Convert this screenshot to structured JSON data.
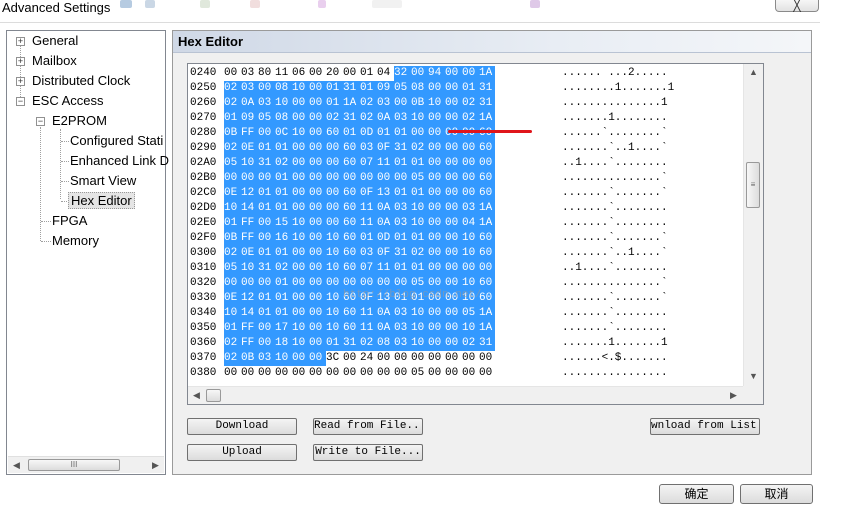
{
  "window": {
    "title": "Advanced Settings",
    "close_label": "╳"
  },
  "tree": {
    "items": [
      {
        "label": "General"
      },
      {
        "label": "Mailbox"
      },
      {
        "label": "Distributed Clock"
      },
      {
        "label": "ESC Access"
      },
      {
        "label": "E2PROM"
      },
      {
        "label": "Configured Stati"
      },
      {
        "label": "Enhanced Link D"
      },
      {
        "label": "Smart View"
      },
      {
        "label": "Hex Editor"
      },
      {
        "label": "FPGA"
      },
      {
        "label": "Memory"
      }
    ],
    "scroll_thumb_glyph": "III"
  },
  "panel": {
    "title": "Hex Editor"
  },
  "hex": {
    "rows": [
      {
        "addr": "0240",
        "bytes": [
          "00",
          "03",
          "80",
          "11",
          "06",
          "00",
          "20",
          "00",
          "01",
          "04",
          "32",
          "00",
          "94",
          "00",
          "00",
          "1A"
        ],
        "sel_from": 10,
        "ascii": "...... ...2....."
      },
      {
        "addr": "0250",
        "bytes": [
          "02",
          "03",
          "00",
          "08",
          "10",
          "00",
          "01",
          "31",
          "01",
          "09",
          "05",
          "08",
          "00",
          "00",
          "01",
          "31"
        ],
        "sel_from": 0,
        "ascii": "........1.......1"
      },
      {
        "addr": "0260",
        "bytes": [
          "02",
          "0A",
          "03",
          "10",
          "00",
          "00",
          "01",
          "1A",
          "02",
          "03",
          "00",
          "0B",
          "10",
          "00",
          "02",
          "31"
        ],
        "sel_from": 0,
        "ascii": "...............1"
      },
      {
        "addr": "0270",
        "bytes": [
          "01",
          "09",
          "05",
          "08",
          "00",
          "00",
          "02",
          "31",
          "02",
          "0A",
          "03",
          "10",
          "00",
          "00",
          "02",
          "1A"
        ],
        "sel_from": 0,
        "ascii": ".......1........"
      },
      {
        "addr": "0280",
        "bytes": [
          "0B",
          "FF",
          "00",
          "0C",
          "10",
          "00",
          "60",
          "01",
          "0D",
          "01",
          "01",
          "00",
          "00",
          "00",
          "00",
          "60"
        ],
        "sel_from": 0,
        "ascii": "......`........`"
      },
      {
        "addr": "0290",
        "bytes": [
          "02",
          "0E",
          "01",
          "01",
          "00",
          "00",
          "00",
          "60",
          "03",
          "0F",
          "31",
          "02",
          "00",
          "00",
          "00",
          "60"
        ],
        "sel_from": 0,
        "ascii": ".......`..1....`"
      },
      {
        "addr": "02A0",
        "bytes": [
          "05",
          "10",
          "31",
          "02",
          "00",
          "00",
          "00",
          "60",
          "07",
          "11",
          "01",
          "01",
          "00",
          "00",
          "00",
          "00"
        ],
        "sel_from": 0,
        "ascii": "..1....`........"
      },
      {
        "addr": "02B0",
        "bytes": [
          "00",
          "00",
          "00",
          "01",
          "00",
          "00",
          "00",
          "00",
          "00",
          "00",
          "00",
          "05",
          "00",
          "00",
          "00",
          "60"
        ],
        "sel_from": 0,
        "ascii": "...............`"
      },
      {
        "addr": "02C0",
        "bytes": [
          "0E",
          "12",
          "01",
          "01",
          "00",
          "00",
          "00",
          "60",
          "0F",
          "13",
          "01",
          "01",
          "00",
          "00",
          "00",
          "60"
        ],
        "sel_from": 0,
        "ascii": ".......`.......`"
      },
      {
        "addr": "02D0",
        "bytes": [
          "10",
          "14",
          "01",
          "01",
          "00",
          "00",
          "00",
          "60",
          "11",
          "0A",
          "03",
          "10",
          "00",
          "00",
          "03",
          "1A"
        ],
        "sel_from": 0,
        "ascii": ".......`........"
      },
      {
        "addr": "02E0",
        "bytes": [
          "01",
          "FF",
          "00",
          "15",
          "10",
          "00",
          "00",
          "60",
          "11",
          "0A",
          "03",
          "10",
          "00",
          "00",
          "04",
          "1A"
        ],
        "sel_from": 0,
        "ascii": ".......`........"
      },
      {
        "addr": "02F0",
        "bytes": [
          "0B",
          "FF",
          "00",
          "16",
          "10",
          "00",
          "10",
          "60",
          "01",
          "0D",
          "01",
          "01",
          "00",
          "00",
          "10",
          "60"
        ],
        "sel_from": 0,
        "ascii": ".......`.......`"
      },
      {
        "addr": "0300",
        "bytes": [
          "02",
          "0E",
          "01",
          "01",
          "00",
          "00",
          "10",
          "60",
          "03",
          "0F",
          "31",
          "02",
          "00",
          "00",
          "10",
          "60"
        ],
        "sel_from": 0,
        "ascii": ".......`..1....`"
      },
      {
        "addr": "0310",
        "bytes": [
          "05",
          "10",
          "31",
          "02",
          "00",
          "00",
          "10",
          "60",
          "07",
          "11",
          "01",
          "01",
          "00",
          "00",
          "00",
          "00"
        ],
        "sel_from": 0,
        "ascii": "..1....`........"
      },
      {
        "addr": "0320",
        "bytes": [
          "00",
          "00",
          "00",
          "01",
          "00",
          "00",
          "00",
          "00",
          "00",
          "00",
          "00",
          "05",
          "00",
          "00",
          "10",
          "60"
        ],
        "sel_from": 0,
        "ascii": "...............`"
      },
      {
        "addr": "0330",
        "bytes": [
          "0E",
          "12",
          "01",
          "01",
          "00",
          "00",
          "10",
          "60",
          "0F",
          "13",
          "01",
          "01",
          "00",
          "00",
          "10",
          "60"
        ],
        "sel_from": 0,
        "ascii": ".......`.......`"
      },
      {
        "addr": "0340",
        "bytes": [
          "10",
          "14",
          "01",
          "01",
          "00",
          "00",
          "10",
          "60",
          "11",
          "0A",
          "03",
          "10",
          "00",
          "00",
          "05",
          "1A"
        ],
        "sel_from": 0,
        "ascii": ".......`........"
      },
      {
        "addr": "0350",
        "bytes": [
          "01",
          "FF",
          "00",
          "17",
          "10",
          "00",
          "10",
          "60",
          "11",
          "0A",
          "03",
          "10",
          "00",
          "00",
          "10",
          "1A"
        ],
        "sel_from": 0,
        "ascii": ".......`........"
      },
      {
        "addr": "0360",
        "bytes": [
          "02",
          "FF",
          "00",
          "18",
          "10",
          "00",
          "01",
          "31",
          "02",
          "08",
          "03",
          "10",
          "00",
          "00",
          "02",
          "31"
        ],
        "sel_from": 0,
        "ascii": ".......1.......1"
      },
      {
        "addr": "0370",
        "bytes": [
          "02",
          "0B",
          "03",
          "10",
          "00",
          "00",
          "3C",
          "00",
          "24",
          "00",
          "00",
          "00",
          "00",
          "00",
          "00",
          "00"
        ],
        "sel_from": 0,
        "sel_to": 5,
        "ascii": "......<.$......."
      },
      {
        "addr": "0380",
        "bytes": [
          "00",
          "00",
          "00",
          "00",
          "00",
          "00",
          "00",
          "00",
          "00",
          "00",
          "00",
          "05",
          "00",
          "00",
          "00",
          "00"
        ],
        "sel_from": 99,
        "ascii": "................"
      }
    ]
  },
  "watermark": "http://blog.csdn.net/",
  "buttons": {
    "download": "Download",
    "read_from_file": "Read from File...",
    "download_from_list": "wnload from List...",
    "upload": "Upload",
    "write_to_file": "Write to File...",
    "ok": "确定",
    "cancel": "取消"
  },
  "colors": {
    "selection": "#3399ff",
    "underline": "#e0151b"
  }
}
